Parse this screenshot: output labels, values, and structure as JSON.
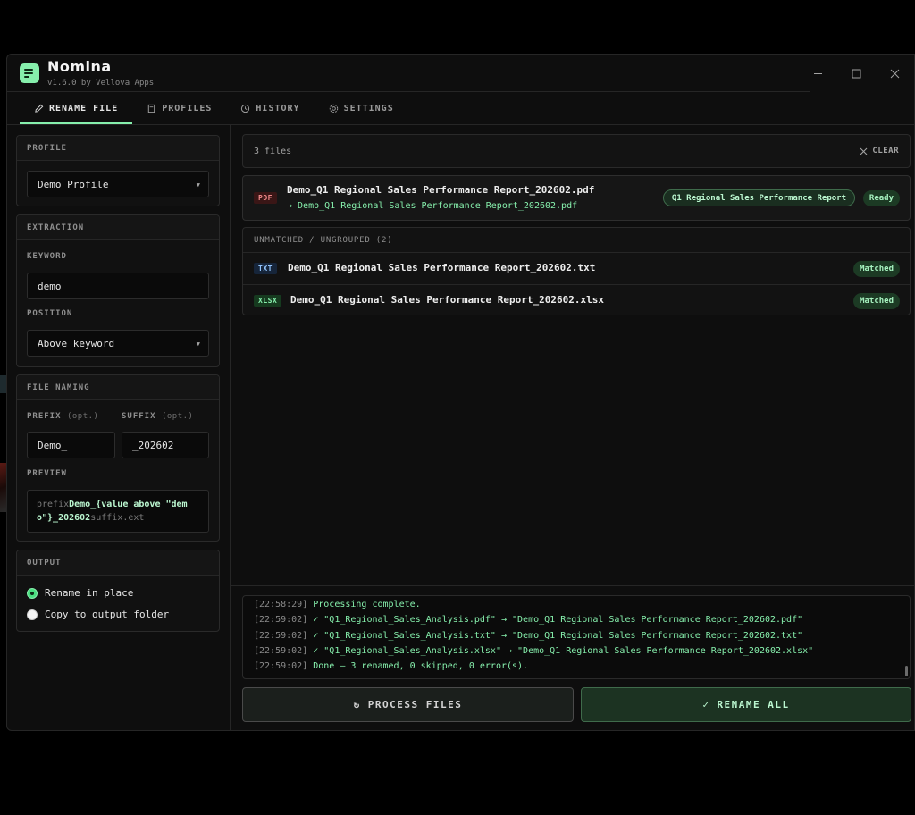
{
  "app": {
    "title": "Nomina",
    "version": "v1.6.0 by Vellova Apps",
    "window_controls": {
      "minimize": "—",
      "maximize": "☐",
      "close": "✕"
    }
  },
  "tabs": [
    {
      "label": "RENAME FILE",
      "icon": "pencil-icon",
      "active": true
    },
    {
      "label": "PROFILES",
      "icon": "document-icon",
      "active": false
    },
    {
      "label": "HISTORY",
      "icon": "history-icon",
      "active": false
    },
    {
      "label": "SETTINGS",
      "icon": "gear-icon",
      "active": false
    }
  ],
  "sidebar": {
    "profile": {
      "header": "PROFILE",
      "selected": "Demo Profile"
    },
    "extraction": {
      "header": "EXTRACTION",
      "keyword_label": "KEYWORD",
      "keyword_value": "demo",
      "position_label": "POSITION",
      "position_value": "Above keyword"
    },
    "naming": {
      "header": "FILE NAMING",
      "prefix_label": "PREFIX",
      "suffix_label": "SUFFIX",
      "opt": "(opt.)",
      "prefix_value": "Demo_",
      "suffix_value": "_202602",
      "preview_label": "PREVIEW",
      "preview": {
        "prefix_tag": "prefix",
        "body": "Demo_{value above \"demo\"}_202602",
        "suffix_tag": "suffix",
        "ext": ".ext"
      }
    },
    "output": {
      "header": "OUTPUT",
      "options": [
        {
          "label": "Rename in place",
          "selected": true
        },
        {
          "label": "Copy to output folder",
          "selected": false
        }
      ]
    }
  },
  "main": {
    "file_count": "3 files",
    "clear_label": "CLEAR",
    "primary_file": {
      "type": "PDF",
      "name": "Demo_Q1 Regional Sales Performance Report_202602.pdf",
      "new_name": "→ Demo_Q1 Regional Sales Performance Report_202602.pdf",
      "group": "Q1 Regional Sales Performance Report",
      "status": "Ready"
    },
    "ungrouped": {
      "header": "UNMATCHED / UNGROUPED (2)",
      "files": [
        {
          "type": "TXT",
          "name": "Demo_Q1 Regional Sales Performance Report_202602.txt",
          "status": "Matched"
        },
        {
          "type": "XLSX",
          "name": "Demo_Q1 Regional Sales Performance Report_202602.xlsx",
          "status": "Matched"
        }
      ]
    },
    "log": [
      {
        "ts": "[22:58:29]",
        "msg": "Processing complete."
      },
      {
        "ts": "[22:59:02]",
        "msg": "✓ \"Q1_Regional_Sales_Analysis.pdf\" → \"Demo_Q1 Regional Sales Performance Report_202602.pdf\""
      },
      {
        "ts": "[22:59:02]",
        "msg": "✓ \"Q1_Regional_Sales_Analysis.txt\" → \"Demo_Q1 Regional Sales Performance Report_202602.txt\""
      },
      {
        "ts": "[22:59:02]",
        "msg": "✓ \"Q1_Regional_Sales_Analysis.xlsx\" → \"Demo_Q1 Regional Sales Performance Report_202602.xlsx\""
      },
      {
        "ts": "[22:59:02]",
        "msg": "Done — 3 renamed, 0 skipped, 0 error(s)."
      }
    ],
    "process_button": "PROCESS FILES",
    "process_icon": "↻",
    "rename_button": "RENAME ALL",
    "rename_icon": "✓"
  }
}
